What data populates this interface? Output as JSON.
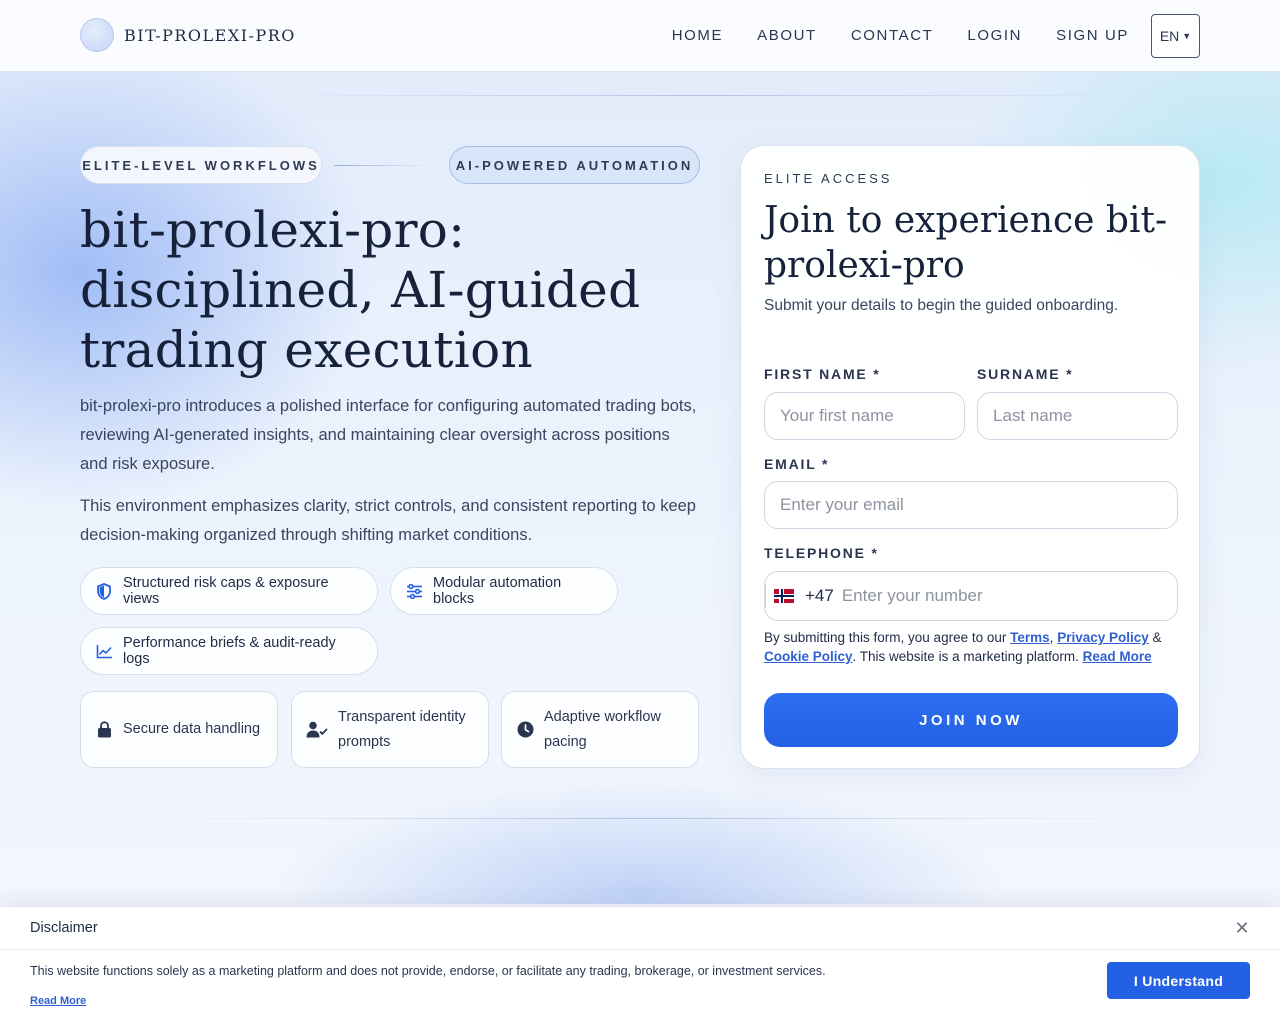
{
  "brand": {
    "name": "BIT-PROLEXI-PRO"
  },
  "nav": {
    "items": [
      {
        "label": "HOME"
      },
      {
        "label": "ABOUT"
      },
      {
        "label": "CONTACT"
      },
      {
        "label": "LOGIN"
      },
      {
        "label": "SIGN UP"
      }
    ],
    "language": "EN"
  },
  "hero": {
    "pills": [
      "ELITE-LEVEL WORKFLOWS",
      "AI-POWERED AUTOMATION"
    ],
    "title": "bit-prolexi-pro: disciplined, AI-guided trading execution",
    "paragraphs": [
      "bit-prolexi-pro introduces a polished interface for configuring automated trading bots, reviewing AI-generated insights, and maintaining clear oversight across positions and risk exposure.",
      "This environment emphasizes clarity, strict controls, and consistent reporting to keep decision-making organized through shifting market conditions."
    ],
    "features": [
      {
        "label": "Structured risk caps & exposure views",
        "icon": "shield-icon"
      },
      {
        "label": "Modular automation blocks",
        "icon": "sliders-icon"
      },
      {
        "label": "Performance briefs & audit-ready logs",
        "icon": "line-chart-icon"
      }
    ],
    "cards": [
      {
        "label": "Secure data handling",
        "icon": "lock-icon"
      },
      {
        "label": "Transparent identity prompts",
        "icon": "user-check-icon"
      },
      {
        "label": "Adaptive workflow pacing",
        "icon": "clock-icon"
      }
    ]
  },
  "form": {
    "eyebrow": "ELITE ACCESS",
    "title": "Join to experience bit-prolexi-pro",
    "subtitle": "Submit your details to begin the guided onboarding.",
    "first_name": {
      "label": "FIRST NAME *",
      "placeholder": "Your first name",
      "value": ""
    },
    "surname": {
      "label": "SURNAME *",
      "placeholder": "Last name",
      "value": ""
    },
    "email": {
      "label": "EMAIL *",
      "placeholder": "Enter your email",
      "value": ""
    },
    "telephone": {
      "label": "TELEPHONE *",
      "dial_code": "+47",
      "placeholder": "Enter your number",
      "value": "",
      "flag": "norway-flag-icon"
    },
    "consent": {
      "prefix": "By submitting this form, you agree to our",
      "terms": "Terms",
      "comma": ",",
      "privacy": "Privacy Policy",
      "amp": "&",
      "cookie": "Cookie Policy",
      "suffix": ". This website is a marketing platform.",
      "read_more": "Read More"
    },
    "submit_label": "JOIN NOW"
  },
  "disclaimer": {
    "title": "Disclaimer",
    "text": "This website functions solely as a marketing platform and does not provide, endorse, or facilitate any trading, brokerage, or investment services.",
    "read_more": "Read More",
    "button_label": "I Understand"
  },
  "colors": {
    "accent": "#2360e3",
    "link": "#2f5fd0",
    "heading": "#16213a",
    "text": "#3a4560"
  }
}
